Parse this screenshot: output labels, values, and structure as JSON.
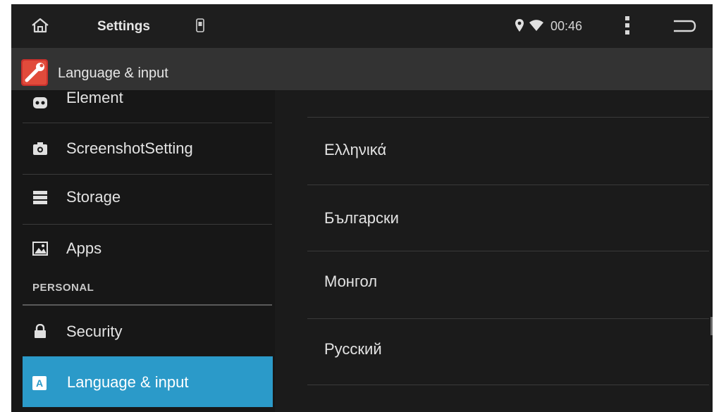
{
  "statusbar": {
    "title": "Settings",
    "time": "00:46",
    "icons": [
      "home-icon",
      "sd-card-icon",
      "location-icon",
      "wifi-icon",
      "overflow-menu-icon",
      "back-icon"
    ]
  },
  "actionbar": {
    "title": "Language & input",
    "icon": "settings-wrench-icon"
  },
  "sidebar": {
    "items": [
      {
        "label": "Element",
        "icon": "element-icon"
      },
      {
        "label": "ScreenshotSetting",
        "icon": "camera-icon"
      },
      {
        "label": "Storage",
        "icon": "storage-icon"
      },
      {
        "label": "Apps",
        "icon": "apps-icon"
      }
    ],
    "section": "PERSONAL",
    "personal_items": [
      {
        "label": "Security",
        "icon": "lock-icon"
      },
      {
        "label": "Language & input",
        "icon": "language-icon",
        "selected": true
      }
    ]
  },
  "languages": [
    "Ελληνικά",
    "Български",
    "Монгол",
    "Русский"
  ],
  "colors": {
    "accent": "#2b9ac9",
    "background": "#1b1b1b",
    "statusbar": "#1e1e1e",
    "actionbar": "#333333"
  }
}
